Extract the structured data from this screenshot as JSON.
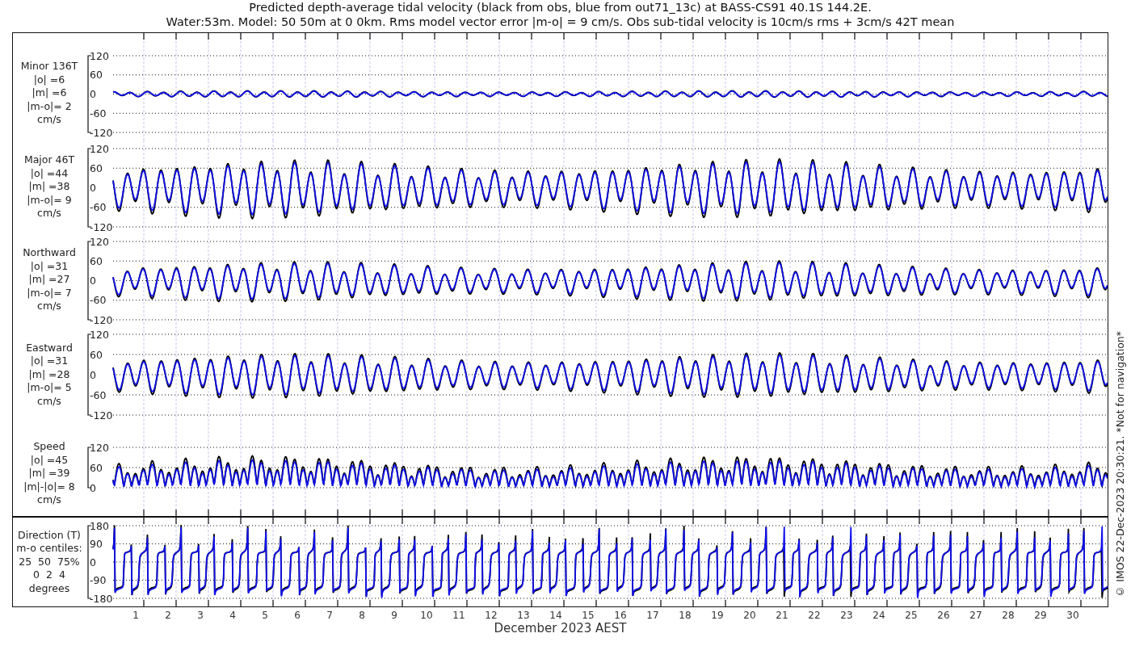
{
  "title": {
    "line_1": "Predicted depth-average tidal velocity (black from obs, blue from out71_13c) at BASS-CS91 40.1S 144.2E.",
    "line_2": "Water:53m. Model: 50 50m at 0 0km. Rms model vector error |m-o| = 9 cm/s. Obs sub-tidal velocity is 10cm/s rms + 3cm/s 42T mean"
  },
  "panels": [
    {
      "kind": "minor",
      "label_lines": [
        "Minor 136T",
        "|o| =6",
        "|m| =6",
        "|m-o|= 2",
        "cm/s"
      ],
      "yticks": [
        "120",
        "60",
        "0",
        "-60",
        "-120"
      ]
    },
    {
      "kind": "major",
      "label_lines": [
        "Major 46T",
        "|o| =44",
        "|m| =38",
        "|m-o|= 9",
        "cm/s"
      ],
      "yticks": [
        "120",
        "60",
        "0",
        "-60",
        "-120"
      ]
    },
    {
      "kind": "northward",
      "label_lines": [
        "Northward",
        "|o| =31",
        "|m| =27",
        "|m-o|= 7",
        "cm/s"
      ],
      "yticks": [
        "120",
        "60",
        "0",
        "-60",
        "-120"
      ]
    },
    {
      "kind": "eastward",
      "label_lines": [
        "Eastward",
        "|o| =31",
        "|m| =28",
        "|m-o|= 5",
        "cm/s"
      ],
      "yticks": [
        "120",
        "60",
        "0",
        "-60",
        "-120"
      ]
    },
    {
      "kind": "speed",
      "label_lines": [
        "Speed",
        "|o| =45",
        "|m| =39",
        "|m|-|o|= 8",
        "cm/s"
      ],
      "yticks": [
        "120",
        "60",
        "0"
      ]
    },
    {
      "kind": "direction",
      "label_lines": [
        "Direction (T)",
        "m-o centiles:",
        "25  50  75%",
        "0  2  4",
        "degrees"
      ],
      "yticks": [
        "180",
        "90",
        "0",
        "-90",
        "-180"
      ]
    }
  ],
  "x_axis": {
    "ticks": [
      "1",
      "2",
      "3",
      "4",
      "5",
      "6",
      "7",
      "8",
      "9",
      "10",
      "11",
      "12",
      "13",
      "14",
      "15",
      "16",
      "17",
      "18",
      "19",
      "20",
      "21",
      "22",
      "23",
      "24",
      "25",
      "26",
      "27",
      "28",
      "29",
      "30"
    ],
    "label": "December 2023 AEST"
  },
  "credit": "© IMOS 22-Dec-2023 20:30:21. *Not for navigation*"
}
